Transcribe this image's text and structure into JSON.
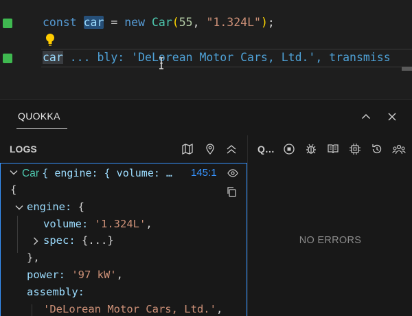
{
  "editor": {
    "line1": {
      "kw_const": "const",
      "var_name": "car",
      "eq": "=",
      "kw_new": "new",
      "class_name": "Car",
      "paren_open": "(",
      "arg1": "55",
      "comma": ",",
      "arg2": "\"1.324L\"",
      "paren_close": ")",
      "semi": ";"
    },
    "line2": {
      "var_name": "car",
      "inline_value": " ... bly: 'DeLorean Motor Cars, Ltd.', transmiss"
    }
  },
  "panel": {
    "tab_label": "QUOKKA",
    "logs": {
      "title": "LOGS",
      "entry": {
        "label_class": "Car",
        "label_preview": "{ engine: { volume: …",
        "location": "145:1"
      },
      "tree": [
        {
          "text": "{"
        },
        {
          "key": "engine:",
          "value": "{"
        },
        {
          "key": "volume:",
          "value": "'1.324L'",
          "suffix": ","
        },
        {
          "key": "spec:",
          "value": "{...}"
        },
        {
          "text": "},"
        },
        {
          "key": "power:",
          "value": "'97 kW'",
          "suffix": ","
        },
        {
          "key": "assembly:"
        },
        {
          "value": "'DeLorean Motor Cars, Ltd.'",
          "suffix": ","
        }
      ]
    },
    "errors": {
      "title": "Q…",
      "empty_message": "NO ERRORS"
    }
  },
  "icons": {
    "accent": "#3794ff",
    "gutter_green": "#3fb950"
  }
}
